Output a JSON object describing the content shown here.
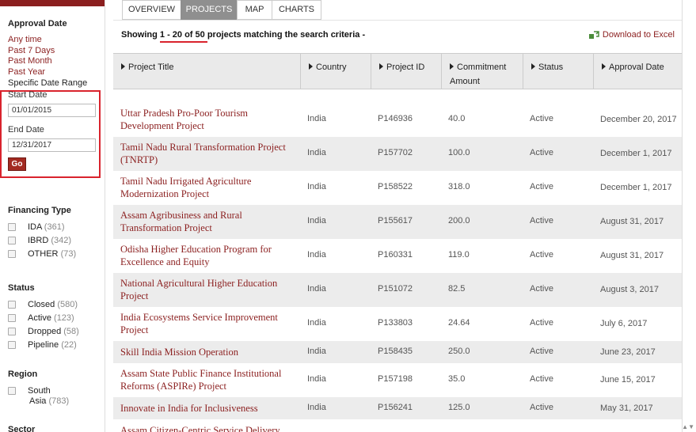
{
  "sidebar": {
    "approval_date": {
      "heading": "Approval Date",
      "links": [
        "Any time",
        "Past 7 Days",
        "Past Month",
        "Past Year"
      ],
      "specific_label": "Specific Date Range",
      "start_label": "Start Date",
      "start_value": "01/01/2015",
      "end_label": "End Date",
      "end_value": "12/31/2017",
      "go_label": "Go"
    },
    "financing_type": {
      "heading": "Financing Type",
      "items": [
        {
          "label": "IDA",
          "count": "(361)"
        },
        {
          "label": "IBRD",
          "count": "(342)"
        },
        {
          "label": "OTHER",
          "count": "(73)"
        }
      ]
    },
    "status": {
      "heading": "Status",
      "items": [
        {
          "label": "Closed",
          "count": "(580)"
        },
        {
          "label": "Active",
          "count": "(123)"
        },
        {
          "label": "Dropped",
          "count": "(58)"
        },
        {
          "label": "Pipeline",
          "count": "(22)"
        }
      ]
    },
    "region": {
      "heading": "Region",
      "items": [
        {
          "label_line1": "South",
          "label_line2": "Asia",
          "count": "(783)"
        }
      ]
    },
    "sector": {
      "heading": "Sector"
    }
  },
  "tabs": [
    "OVERVIEW",
    "PROJECTS",
    "MAP",
    "CHARTS"
  ],
  "summary": {
    "prefix": "Showing ",
    "range": "1 - 20 of 50 ",
    "suffix": " projects matching the search criteria -",
    "download_label": "Download to Excel"
  },
  "columns": [
    "Project Title",
    "Country",
    "Project ID",
    "Commitment Amount",
    "Status",
    "Approval Date"
  ],
  "rows": [
    {
      "title": "Uttar Pradesh Pro-Poor Tourism Development Project",
      "country": "India",
      "id": "P146936",
      "amount": "40.0",
      "status": "Active",
      "date": "December 20, 2017"
    },
    {
      "title": "Tamil Nadu Rural Transformation Project (TNRTP)",
      "country": "India",
      "id": "P157702",
      "amount": "100.0",
      "status": "Active",
      "date": "December 1, 2017"
    },
    {
      "title": "Tamil Nadu Irrigated Agriculture Modernization Project",
      "country": "India",
      "id": "P158522",
      "amount": "318.0",
      "status": "Active",
      "date": "December 1, 2017"
    },
    {
      "title": "Assam Agribusiness and Rural Transformation Project",
      "country": "India",
      "id": "P155617",
      "amount": "200.0",
      "status": "Active",
      "date": "August 31, 2017"
    },
    {
      "title": "Odisha Higher Education Program for Excellence and Equity",
      "country": "India",
      "id": "P160331",
      "amount": "119.0",
      "status": "Active",
      "date": "August 31, 2017"
    },
    {
      "title": "National Agricultural Higher Education Project",
      "country": "India",
      "id": "P151072",
      "amount": "82.5",
      "status": "Active",
      "date": "August 3, 2017"
    },
    {
      "title": "India Ecosystems Service Improvement Project",
      "country": "India",
      "id": "P133803",
      "amount": "24.64",
      "status": "Active",
      "date": "July 6, 2017"
    },
    {
      "title": "Skill India Mission Operation",
      "country": "India",
      "id": "P158435",
      "amount": "250.0",
      "status": "Active",
      "date": "June 23, 2017"
    },
    {
      "title": "Assam State Public Finance Institutional Reforms (ASPIRe) Project",
      "country": "India",
      "id": "P157198",
      "amount": "35.0",
      "status": "Active",
      "date": "June 15, 2017"
    },
    {
      "title": "Innovate in India for Inclusiveness",
      "country": "India",
      "id": "P156241",
      "amount": "125.0",
      "status": "Active",
      "date": "May 31, 2017"
    },
    {
      "title": "Assam Citizen-Centric Service Delivery",
      "country": "",
      "id": "",
      "amount": "",
      "status": "",
      "date": ""
    }
  ]
}
